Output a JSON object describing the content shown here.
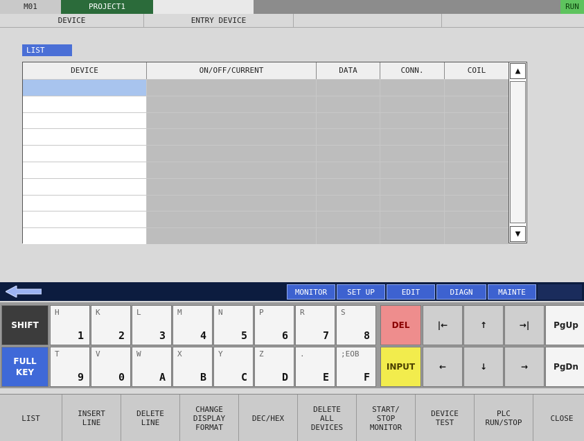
{
  "status": {
    "id": "M01",
    "project": "PROJECT1",
    "state": "RUN"
  },
  "tabs": [
    "DEVICE",
    "ENTRY DEVICE",
    "",
    ""
  ],
  "list_label": "LIST",
  "table": {
    "headers": [
      "DEVICE",
      "ON/OFF/CURRENT",
      "DATA",
      "CONN.",
      "COIL"
    ],
    "row_count": 10
  },
  "menu": [
    "MONITOR",
    "SET UP",
    "EDIT",
    "DIAGN",
    "MAINTE"
  ],
  "keys": {
    "shift": "SHIFT",
    "full_key": "FULL\nKEY",
    "row1": [
      {
        "sub": "H",
        "main": "1"
      },
      {
        "sub": "K",
        "main": "2"
      },
      {
        "sub": "L",
        "main": "3"
      },
      {
        "sub": "M",
        "main": "4"
      },
      {
        "sub": "N",
        "main": "5"
      },
      {
        "sub": "P",
        "main": "6"
      },
      {
        "sub": "R",
        "main": "7"
      },
      {
        "sub": "S",
        "main": "8"
      }
    ],
    "row2": [
      {
        "sub": "T",
        "main": "9"
      },
      {
        "sub": "V",
        "main": "0"
      },
      {
        "sub": "W",
        "main": "A"
      },
      {
        "sub": "X",
        "main": "B"
      },
      {
        "sub": "Y",
        "main": "C"
      },
      {
        "sub": "Z",
        "main": "D"
      },
      {
        "sub": ".",
        "main": "E"
      },
      {
        "sub": ";EOB",
        "main": "F"
      }
    ],
    "del": "DEL",
    "input": "INPUT",
    "nav_row1": [
      "|←",
      "↑",
      "→|",
      "PgUp"
    ],
    "nav_row2": [
      "←",
      "↓",
      "→",
      "PgDn"
    ]
  },
  "function_keys": [
    "LIST",
    "INSERT\nLINE",
    "DELETE\nLINE",
    "CHANGE\nDISPLAY\nFORMAT",
    "DEC/HEX",
    "DELETE\nALL\nDEVICES",
    "START/\nSTOP\nMONITOR",
    "DEVICE\nTEST",
    "PLC\nRUN/STOP",
    "CLOSE"
  ],
  "colors": {
    "project_bg": "#2b6b3a",
    "run_bg": "#5ec35e",
    "menu_bar": "#0c1c3f",
    "menu_btn": "#3d62d0",
    "del_key": "#ee8d8d",
    "input_key": "#f2ec4d",
    "fullkey": "#3f69d8"
  },
  "icons": {
    "back": "left-arrow-icon",
    "scroll_up": "triangle-up-icon",
    "scroll_down": "triangle-down-icon"
  }
}
